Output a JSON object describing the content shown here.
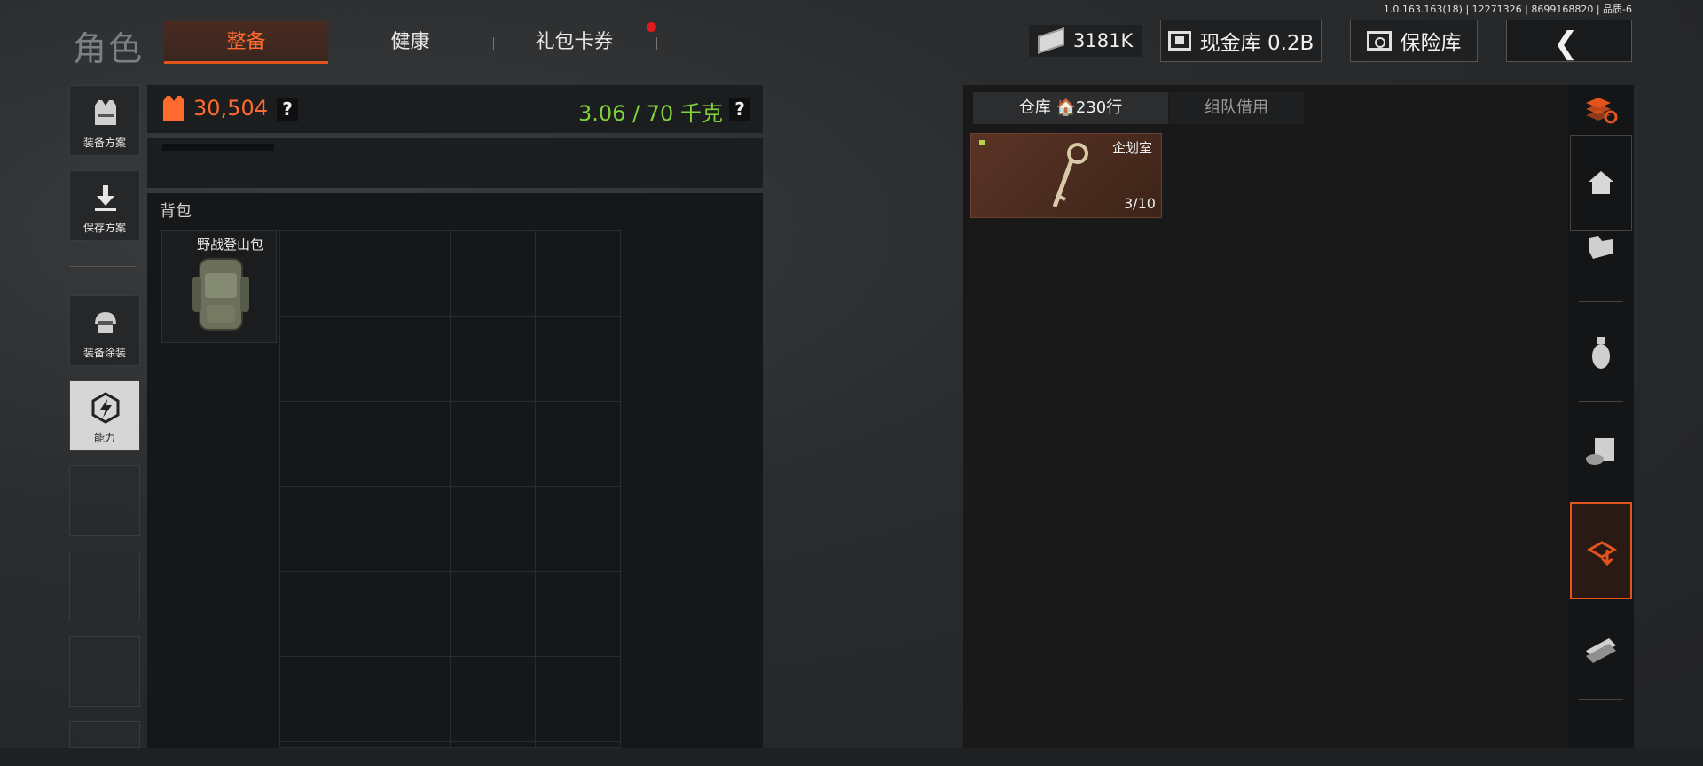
{
  "version_text": "1.0.163.163(18) | 12271326 | 8699168820 | 品质-6",
  "page_title": "角色",
  "tabs": [
    {
      "label": "整备",
      "active": true
    },
    {
      "label": "健康"
    },
    {
      "label": "礼包卡券",
      "has_notification": true
    }
  ],
  "currency": {
    "icon": "money-icon",
    "value": "3181K"
  },
  "cash_vault": {
    "icon": "vault-icon",
    "label": "现金库 0.2B"
  },
  "safe_vault": {
    "icon": "safe-icon",
    "label": "保险库"
  },
  "back_icon": "chevron-left-icon",
  "sidebar": {
    "items": [
      {
        "label": "装备方案",
        "icon": "vest-icon"
      },
      {
        "label": "保存方案",
        "icon": "download-icon"
      },
      {
        "label": "装备涂装",
        "icon": "helmet-icon"
      },
      {
        "label": "能力",
        "icon": "lightning-icon",
        "active": true
      }
    ]
  },
  "loadout": {
    "value": "30,504",
    "help": "?",
    "weight": "3.06 / 70 千克",
    "weight_help": "?"
  },
  "backpack": {
    "title": "背包",
    "item_name": "野战登山包"
  },
  "warehouse": {
    "tabs": [
      {
        "label": "仓库 🏠230行",
        "active": true
      },
      {
        "label": "组队借用"
      }
    ],
    "items": [
      {
        "name": "企划室",
        "count": "3/10"
      }
    ]
  },
  "colors": {
    "accent": "#e2541d",
    "weight_green": "#7fd13b",
    "value_orange": "#ff6a2e"
  }
}
